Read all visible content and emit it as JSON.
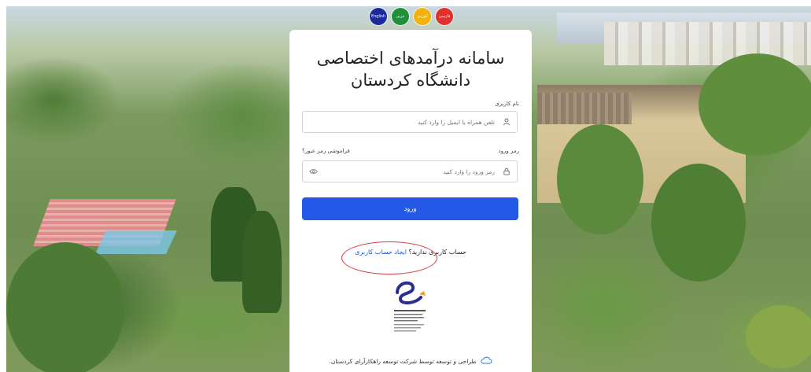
{
  "languages": [
    {
      "label": "فارسی",
      "color": "#e0312d"
    },
    {
      "label": "کوردی",
      "color": "#f1b20a"
    },
    {
      "label": "عربی",
      "color": "#1f8f3a"
    },
    {
      "label": "English",
      "color": "#1c2a9e"
    }
  ],
  "title": {
    "line1": "سامانه درآمدهای اختصاصی",
    "line2": "دانشگاه کردستان"
  },
  "username": {
    "label": "نام کاربری",
    "placeholder": "تلفن همراه یا ایمیل را وارد کنید"
  },
  "password": {
    "label": "رمز ورود",
    "forgot": "فراموشی رمز عبور؟",
    "placeholder": "رمز ورود را وارد کنید"
  },
  "login_button": "ورود",
  "signup": {
    "question": "حساب کاربری ندارید؟",
    "link": "ایجاد حساب کاربری"
  },
  "footer": {
    "text": "طراحی و توسعه توسط شرکت توسعه راهکارآرای کردستان."
  },
  "colors": {
    "primary": "#2359e6",
    "link": "#1a56d6",
    "highlight_oval": "#d63a3a"
  },
  "icons": {
    "user": "user-icon",
    "lock": "lock-icon",
    "eye": "eye-icon",
    "cloud": "cloud-icon",
    "trust_seal": "enamad-seal"
  }
}
